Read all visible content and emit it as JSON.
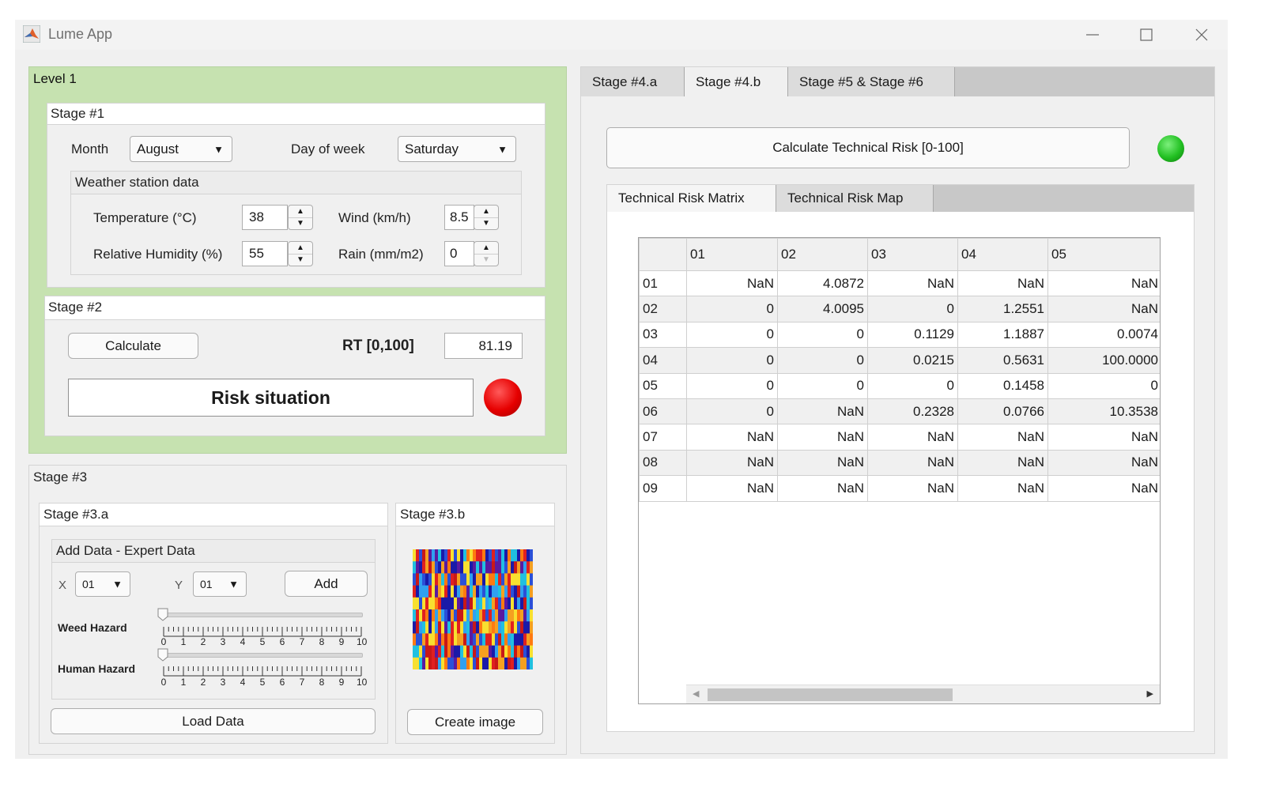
{
  "window": {
    "title": "Lume App"
  },
  "level1": {
    "title": "Level 1",
    "stage1": {
      "title": "Stage #1",
      "month_label": "Month",
      "month_value": "August",
      "dow_label": "Day of week",
      "dow_value": "Saturday",
      "weather": {
        "title": "Weather station data",
        "temperature_label": "Temperature (°C)",
        "temperature_value": "38",
        "wind_label": "Wind (km/h)",
        "wind_value": "8.5",
        "humidity_label": "Relative Humidity (%)",
        "humidity_value": "55",
        "rain_label": "Rain (mm/m2)",
        "rain_value": "0"
      }
    },
    "stage2": {
      "title": "Stage #2",
      "calculate_label": "Calculate",
      "rt_label": "RT [0,100]",
      "rt_value": "81.19",
      "status_text": "Risk situation",
      "status_color": "#e60000"
    }
  },
  "stage3": {
    "title": "Stage #3",
    "a": {
      "title": "Stage #3.a",
      "add_title": "Add Data - Expert Data",
      "x_label": "X",
      "x_value": "01",
      "y_label": "Y",
      "y_value": "01",
      "add_label": "Add",
      "weed_label": "Weed Hazard",
      "human_label": "Human Hazard",
      "weed_value": 0,
      "human_value": 0,
      "ticks": [
        "0",
        "1",
        "2",
        "3",
        "4",
        "5",
        "6",
        "7",
        "8",
        "9",
        "10"
      ],
      "load_label": "Load Data"
    },
    "b": {
      "title": "Stage #3.b",
      "create_label": "Create image"
    }
  },
  "right": {
    "tabs": [
      "Stage #4.a",
      "Stage #4.b",
      "Stage #5 & Stage #6"
    ],
    "active_tab": 1,
    "calc_label": "Calculate Technical Risk [0-100]",
    "status_color": "#22c022",
    "subtabs": [
      "Technical Risk Matrix",
      "Technical Risk Map"
    ],
    "active_subtab": 0,
    "matrix": {
      "columns": [
        "01",
        "02",
        "03",
        "04",
        "05"
      ],
      "rows": [
        {
          "id": "01",
          "cells": [
            "NaN",
            "4.0872",
            "NaN",
            "NaN",
            "NaN"
          ]
        },
        {
          "id": "02",
          "cells": [
            "0",
            "4.0095",
            "0",
            "1.2551",
            "NaN"
          ]
        },
        {
          "id": "03",
          "cells": [
            "0",
            "0",
            "0.1129",
            "1.1887",
            "0.0074"
          ]
        },
        {
          "id": "04",
          "cells": [
            "0",
            "0",
            "0.0215",
            "0.5631",
            "100.0000"
          ]
        },
        {
          "id": "05",
          "cells": [
            "0",
            "0",
            "0",
            "0.1458",
            "0"
          ]
        },
        {
          "id": "06",
          "cells": [
            "0",
            "NaN",
            "0.2328",
            "0.0766",
            "10.3538"
          ]
        },
        {
          "id": "07",
          "cells": [
            "NaN",
            "NaN",
            "NaN",
            "NaN",
            "NaN"
          ]
        },
        {
          "id": "08",
          "cells": [
            "NaN",
            "NaN",
            "NaN",
            "NaN",
            "NaN"
          ]
        },
        {
          "id": "09",
          "cells": [
            "NaN",
            "NaN",
            "NaN",
            "NaN",
            "NaN"
          ]
        }
      ]
    }
  }
}
